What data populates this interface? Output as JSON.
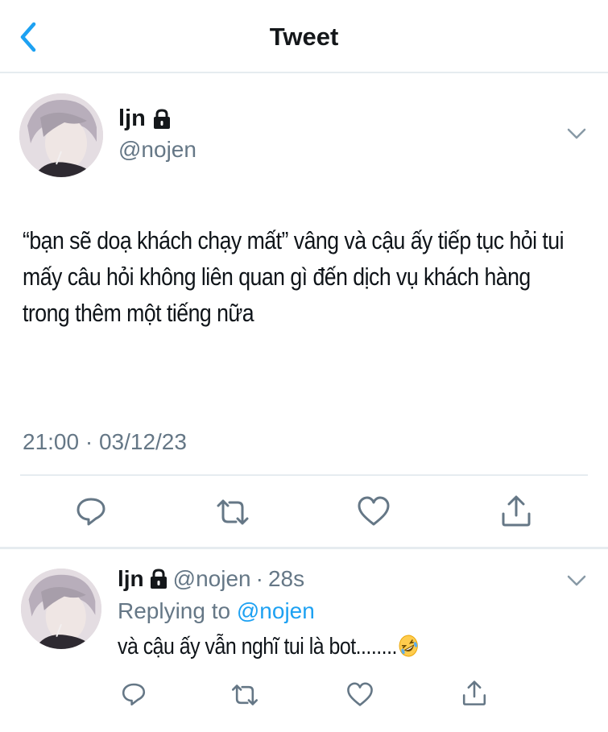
{
  "header": {
    "title": "Tweet",
    "back_icon": "chevron-left-icon"
  },
  "tweet": {
    "author_name": "ljn",
    "author_handle": "@nojen",
    "text": "“bạn sẽ doạ khách chạy mất” vâng và cậu ấy tiếp tục hỏi tui mấy câu hỏi không liên quan gì đến dịch vụ khách hàng trong thêm một tiếng nữa",
    "timestamp": "21:00 · 03/12/23",
    "actions": [
      "reply-icon",
      "retweet-icon",
      "like-icon",
      "share-icon"
    ]
  },
  "reply": {
    "author_name": "ljn",
    "author_handle": "@nojen",
    "separator": "·",
    "time": "28s",
    "replying_prefix": "Replying to",
    "replying_to": "@nojen",
    "text": "và cậu ấy vẫn nghĩ tui là bot........",
    "emoji": "rolling-on-floor-laughing-emoji"
  },
  "colors": {
    "accent": "#1da1f2",
    "muted": "#657786",
    "text": "#14171a",
    "divider": "#e6ecf0"
  }
}
